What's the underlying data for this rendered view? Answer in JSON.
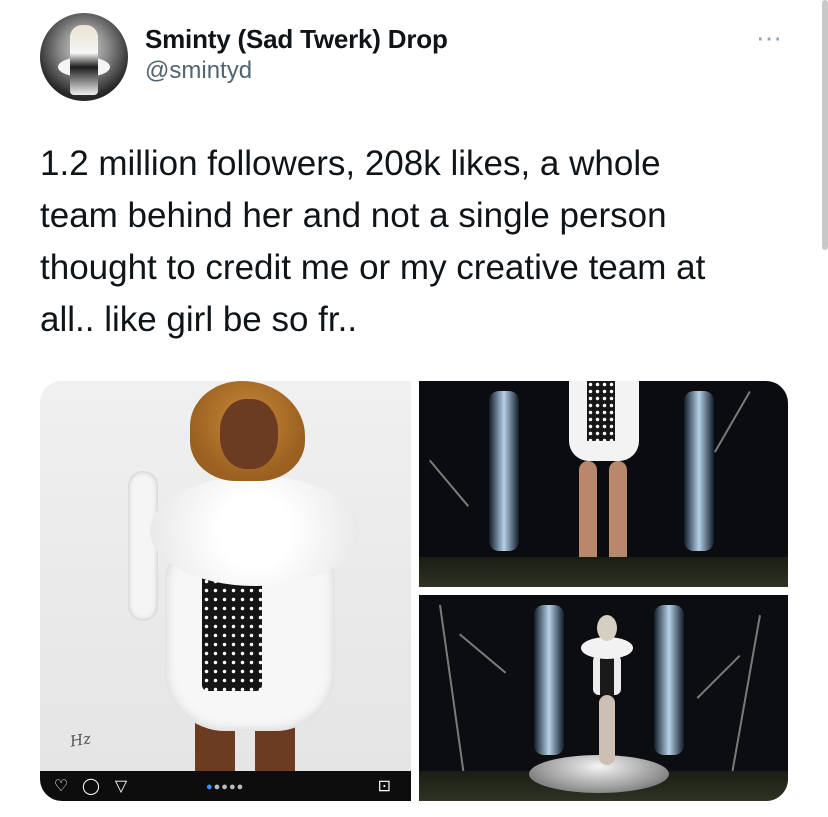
{
  "author": {
    "display_name": "Sminty (Sad Twerk) Drop",
    "handle": "@smintyd"
  },
  "more_icon": "⋯",
  "tweet": {
    "text": "1.2 million followers, 208k likes, a whole\nteam behind her and not a single person\nthought to credit me or my creative team at\nall.. like girl be so fr.."
  },
  "media": {
    "instagram_bar": {
      "icons": [
        "heart-icon",
        "comment-icon",
        "share-icon",
        "bookmark-icon"
      ],
      "carousel_dots_total": 5,
      "carousel_active_index": 0,
      "accent_color": "#3b8eff"
    }
  }
}
